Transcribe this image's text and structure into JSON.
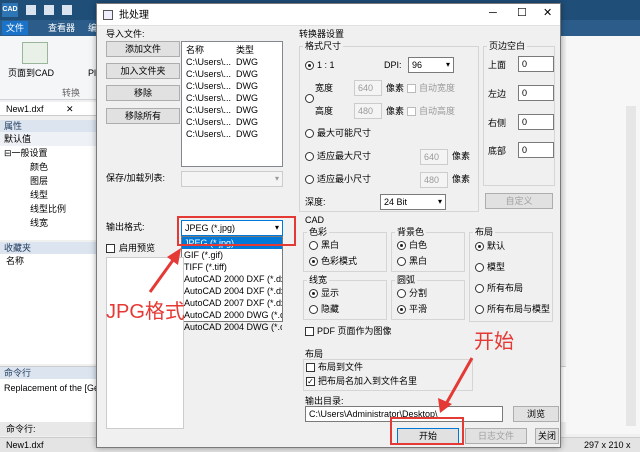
{
  "app": {
    "logo": "CAD",
    "menu": [
      "文件",
      "查看器",
      "编"
    ],
    "ribbon_button": "页面到CAD",
    "ribbon_button2": "Pl",
    "ribbon_group": "转换",
    "doc_tab": "New1.dxf",
    "properties_title": "属性",
    "default_label": "默认值",
    "general_label": "一般设置",
    "props": [
      "颜色",
      "图层",
      "线型",
      "线型比例",
      "线宽"
    ],
    "favorites_title": "收藏夹",
    "name_col": "名称",
    "command_title": "命令行",
    "command_log": "Replacement of the [Gen",
    "command_prompt": "命令行:",
    "status_file": "New1.dxf",
    "status_coords": "297 x 210 x"
  },
  "dialog": {
    "title": "批处理",
    "minimize_icon": "minimize-icon",
    "maximize_icon": "maximize-icon",
    "close_icon": "close-icon",
    "import_label": "导入文件:",
    "add_file": "添加文件",
    "add_folder": "加入文件夹",
    "remove": "移除",
    "remove_all": "移除所有",
    "file_columns": [
      "名称",
      "类型"
    ],
    "files": [
      {
        "name": "C:\\Users\\...",
        "type": "DWG"
      },
      {
        "name": "C:\\Users\\...",
        "type": "DWG"
      },
      {
        "name": "C:\\Users\\...",
        "type": "DWG"
      },
      {
        "name": "C:\\Users\\...",
        "type": "DWG"
      },
      {
        "name": "C:\\Users\\...",
        "type": "DWG"
      },
      {
        "name": "C:\\Users\\...",
        "type": "DWG"
      },
      {
        "name": "C:\\Users\\...",
        "type": "DWG"
      }
    ],
    "save_load_label": "保存/加载列表:",
    "output_format_label": "输出格式:",
    "output_format_value": "JPEG (*.jpg)",
    "format_options": [
      "JPEG (*.jpg)",
      "GIF (*.gif)",
      "TIFF (*.tiff)",
      "AutoCAD 2000 DXF (*.dx",
      "AutoCAD 2004 DXF (*.dx",
      "AutoCAD 2007 DXF (*.dx",
      "AutoCAD 2000 DWG (*.c",
      "AutoCAD 2004 DWG (*.c"
    ],
    "preview_label": "启用预览",
    "converter_title": "转换器设置",
    "format_size_title": "格式尺寸",
    "ratio_label": "1 : 1",
    "dpi_label": "DPI:",
    "dpi_value": "96",
    "width_label": "宽度",
    "width_value": "640",
    "height_label": "高度",
    "height_value": "480",
    "pixel_unit": "像素",
    "auto_width": "自动宽度",
    "auto_height": "自动高度",
    "max_size": "最大可能尺寸",
    "fit_max": "适应最大尺寸",
    "fit_max_value": "640",
    "fit_min": "适应最小尺寸",
    "fit_min_value": "480",
    "depth_label": "深度:",
    "depth_value": "24 Bit",
    "margins_title": "页边空白",
    "margin_top": "上面",
    "margin_left": "左边",
    "margin_right": "右侧",
    "margin_bottom": "底部",
    "margin_top_value": "0",
    "margin_left_value": "0",
    "margin_right_value": "0",
    "margin_bottom_value": "0",
    "custom_button": "自定义",
    "cad_title": "CAD",
    "color_title": "色彩",
    "bw": "黑白",
    "color_mode": "色彩模式",
    "bg_title": "背景色",
    "white": "白色",
    "black": "黑白",
    "layout_title": "布局",
    "default": "默认",
    "model": "模型",
    "all_layouts": "所有布局",
    "all_layouts_model": "所有布局与模型",
    "linetype_title": "线宽",
    "show": "显示",
    "hide": "隐藏",
    "arc_title": "圆弧",
    "split": "分割",
    "smooth": "平滑",
    "pdf_as_image": "PDF 页面作为图像",
    "layout2_title": "布局",
    "layout_to_file": "布局到文件",
    "add_layout_name": "把布局名加入到文件名里",
    "output_dir_label": "输出目录:",
    "output_dir_value": "C:\\Users\\Administrator\\Desktop\\",
    "browse": "浏览",
    "start": "开始",
    "log_file": "日志文件",
    "close": "关闭",
    "annotation_jpg": "JPG格式",
    "annotation_start": "开始"
  },
  "colors": {
    "accent": "#1f4e79",
    "annotation": "#e53935",
    "selection": "#0078d7"
  }
}
